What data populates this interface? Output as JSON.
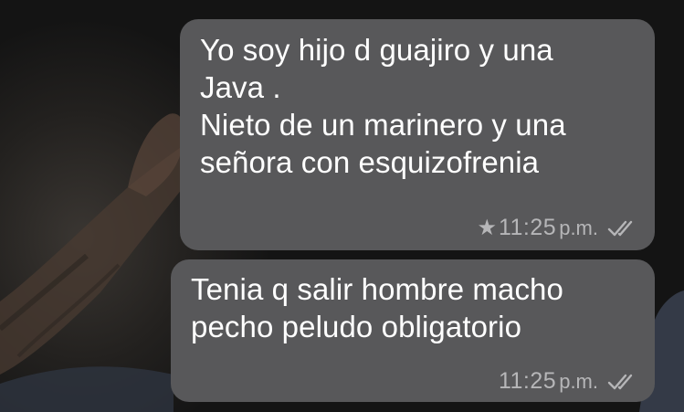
{
  "messages": [
    {
      "text": "Yo soy hijo d guajiro y una\nJava .\nNieto de un marinero y una\nseñora con esquizofrenia",
      "starred": true,
      "time": "11:25",
      "time_suffix": "p.m.",
      "status_icon": "double-check-icon"
    },
    {
      "text": "Tenia q salir hombre macho\npecho peludo obligatorio",
      "starred": false,
      "time": "11:25",
      "time_suffix": "p.m.",
      "status_icon": "double-check-icon"
    }
  ],
  "colors": {
    "bubble": "#58585a",
    "text": "#ffffff",
    "meta": "#b6b6b8"
  }
}
